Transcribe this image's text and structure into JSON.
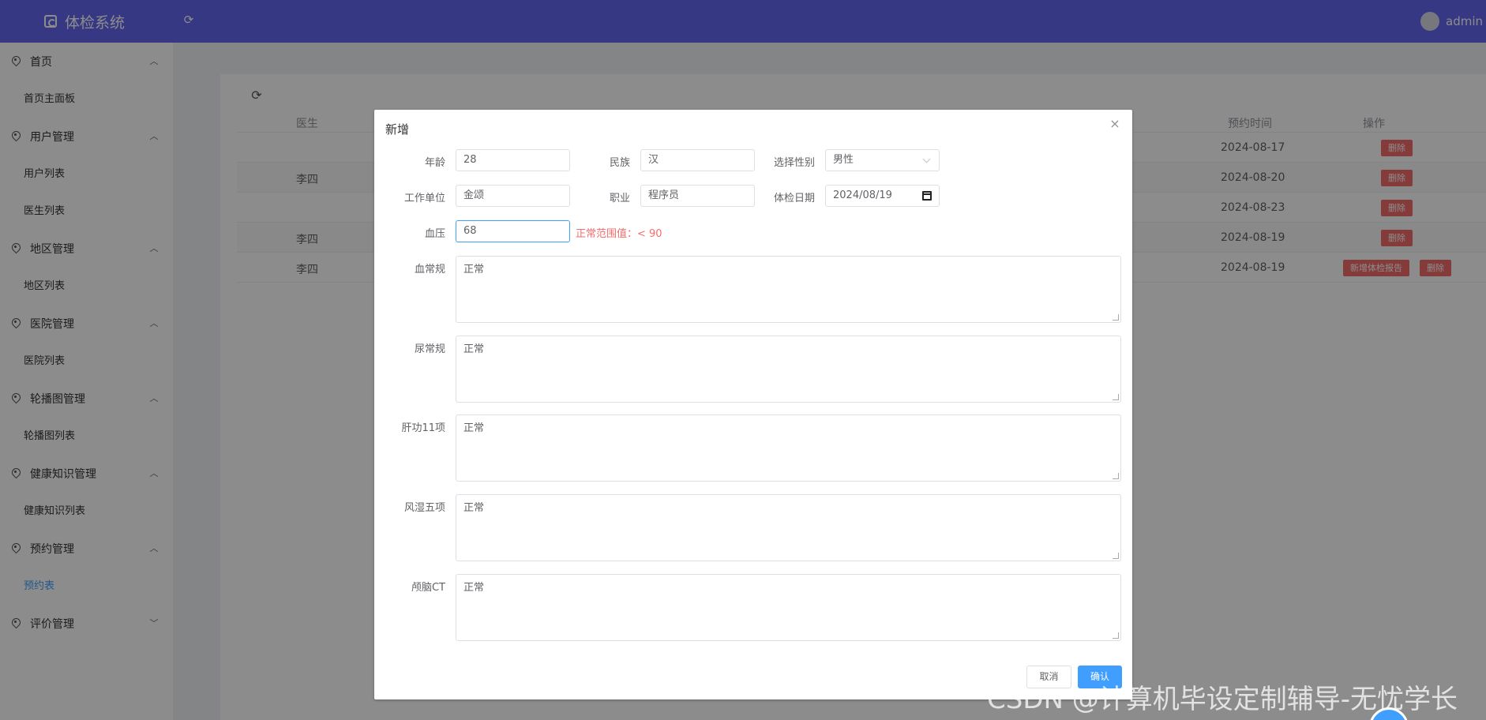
{
  "header": {
    "title": "体检系统",
    "user": "admin"
  },
  "sidebar": {
    "groups": [
      {
        "label": "首页",
        "items": [
          "首页主面板"
        ]
      },
      {
        "label": "用户管理",
        "items": [
          "用户列表",
          "医生列表"
        ]
      },
      {
        "label": "地区管理",
        "items": [
          "地区列表"
        ]
      },
      {
        "label": "医院管理",
        "items": [
          "医院列表"
        ]
      },
      {
        "label": "轮播图管理",
        "items": [
          "轮播图列表"
        ]
      },
      {
        "label": "健康知识管理",
        "items": [
          "健康知识列表"
        ]
      },
      {
        "label": "预约管理",
        "items": [
          "预约表"
        ]
      },
      {
        "label": "评价管理",
        "items": []
      }
    ],
    "active_item": "预约表"
  },
  "table": {
    "headers": {
      "doctor": "医生",
      "time": "预约时间",
      "action": "操作"
    },
    "rows": [
      {
        "doctor": "",
        "time": "2024-08-17",
        "actions": [
          "删除"
        ]
      },
      {
        "doctor": "李四",
        "time": "2024-08-20",
        "actions": [
          "删除"
        ]
      },
      {
        "doctor": "",
        "time": "2024-08-23",
        "actions": [
          "删除"
        ]
      },
      {
        "doctor": "李四",
        "time": "2024-08-19",
        "actions": [
          "删除"
        ]
      },
      {
        "doctor": "李四",
        "time": "2024-08-19",
        "actions": [
          "新增体检报告",
          "删除"
        ]
      }
    ]
  },
  "dialog": {
    "title": "新增",
    "fields": {
      "age": {
        "label": "年龄",
        "value": "28"
      },
      "ethnicity": {
        "label": "民族",
        "value": "汉"
      },
      "gender": {
        "label": "选择性别",
        "value": "男性"
      },
      "workplace": {
        "label": "工作单位",
        "value": "金颂"
      },
      "occupation": {
        "label": "职业",
        "value": "程序员"
      },
      "exam_date": {
        "label": "体检日期",
        "value": "2024/08/19"
      },
      "blood_pressure": {
        "label": "血压",
        "value": "68",
        "hint": "正常范围值：< 90"
      },
      "blood_routine": {
        "label": "血常规",
        "value": "正常"
      },
      "urine_routine": {
        "label": "尿常规",
        "value": "正常"
      },
      "liver_function": {
        "label": "肝功11项",
        "value": "正常"
      },
      "rheumatism": {
        "label": "风湿五项",
        "value": "正常"
      },
      "head_ct": {
        "label": "颅脑CT",
        "value": "正常"
      }
    },
    "cancel_label": "取消",
    "confirm_label": "确认"
  },
  "watermark": "CSDN @计算机毕设定制辅导-无忧学长",
  "colors": {
    "header": "#6366f1",
    "primary": "#409eff",
    "danger": "#f56c6c"
  }
}
